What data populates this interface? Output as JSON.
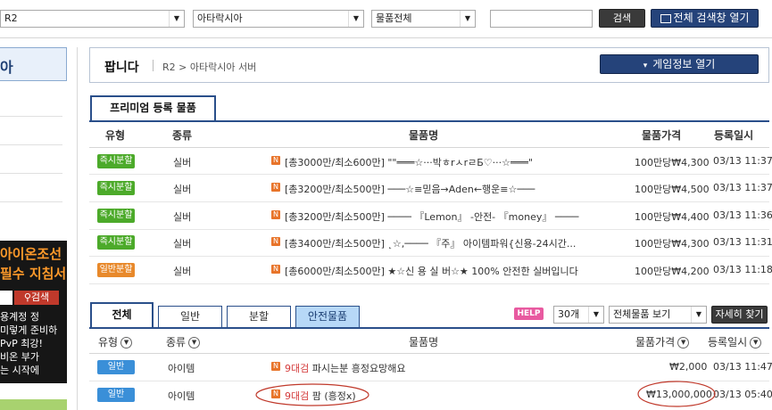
{
  "topbar": {
    "server_select": "R2",
    "world_select": "아타락시아",
    "category_select": "물품전체",
    "search_value": "",
    "search_button": "검색",
    "full_search_button": "전체 검색창 열기"
  },
  "sidebar": {
    "header_text": "아",
    "banner": {
      "line1": "아이온조선",
      "line2": "필수 지침서!",
      "search_label": "검색",
      "lines": [
        "용계정 정",
        "미렇게 준비하",
        "PvP 최강!",
        "비온 부가",
        "는 시작에"
      ]
    }
  },
  "header": {
    "title": "팝니다",
    "breadcrumb_server": "R2",
    "breadcrumb_sep": ">",
    "breadcrumb_world": "아타락시아 서버",
    "game_info_button": "게임정보 열기"
  },
  "premium": {
    "tab_label": "프리미엄 등록 물품",
    "columns": [
      "유형",
      "종류",
      "물품명",
      "물품가격",
      "등록일시"
    ],
    "rows": [
      {
        "type": "즉시분할",
        "type_color": "green",
        "kind": "실버",
        "name": "[총3000만/최소600만] \"\"═══☆···박ㅎrㅅrㄹБ♡···☆═══\"",
        "price": "100만당₩4,300",
        "date": "03/13 11:37"
      },
      {
        "type": "즉시분할",
        "type_color": "green",
        "kind": "실버",
        "name": "[총3200만/최소500만] ───☆≡믿음→Aden←행운≡☆───",
        "price": "100만당₩4,500",
        "date": "03/13 11:37"
      },
      {
        "type": "즉시분할",
        "type_color": "green",
        "kind": "실버",
        "name": "[총3200만/최소500만] ──── 『Lemon』 -안전- 『money』 ────",
        "price": "100만당₩4,400",
        "date": "03/13 11:36"
      },
      {
        "type": "즉시분할",
        "type_color": "green",
        "kind": "실버",
        "name": "[총3400만/최소500만] ˛☆,──── 『주』 아이템파워{신용-24시간...",
        "price": "100만당₩4,300",
        "date": "03/13 11:31"
      },
      {
        "type": "일반분할",
        "type_color": "orange",
        "kind": "실버",
        "name": "[총6000만/최소500만] ★☆신 용 실 버☆★ 100% 안전한 실버입니다",
        "price": "100만당₩4,200",
        "date": "03/13 11:18"
      }
    ]
  },
  "list": {
    "tabs": [
      "전체",
      "일반",
      "분할",
      "안전물품"
    ],
    "help_label": "HELP",
    "per_page": "30개",
    "view_select": "전체물품 보기",
    "detail_button": "자세히 찾기",
    "columns": [
      "유형",
      "종류",
      "물품명",
      "물품가격",
      "등록일시"
    ],
    "rows": [
      {
        "type": "일반",
        "kind": "아이템",
        "name_prefix": "9대검",
        "name_rest": " 파시는분 흥정요망해요",
        "price": "₩2,000",
        "date": "03/13 11:47"
      },
      {
        "type": "일반",
        "kind": "아이템",
        "name_prefix": "9대검",
        "name_rest": " 팜 (흥정x)",
        "price": "₩13,000,000",
        "date": "03/13 05:40"
      }
    ]
  },
  "colors": {
    "navy": "#25437a",
    "green_badge": "#4caa2a",
    "orange_badge": "#e8892b",
    "blue_badge": "#3a8fd8",
    "annotation_red": "#c0392b"
  }
}
